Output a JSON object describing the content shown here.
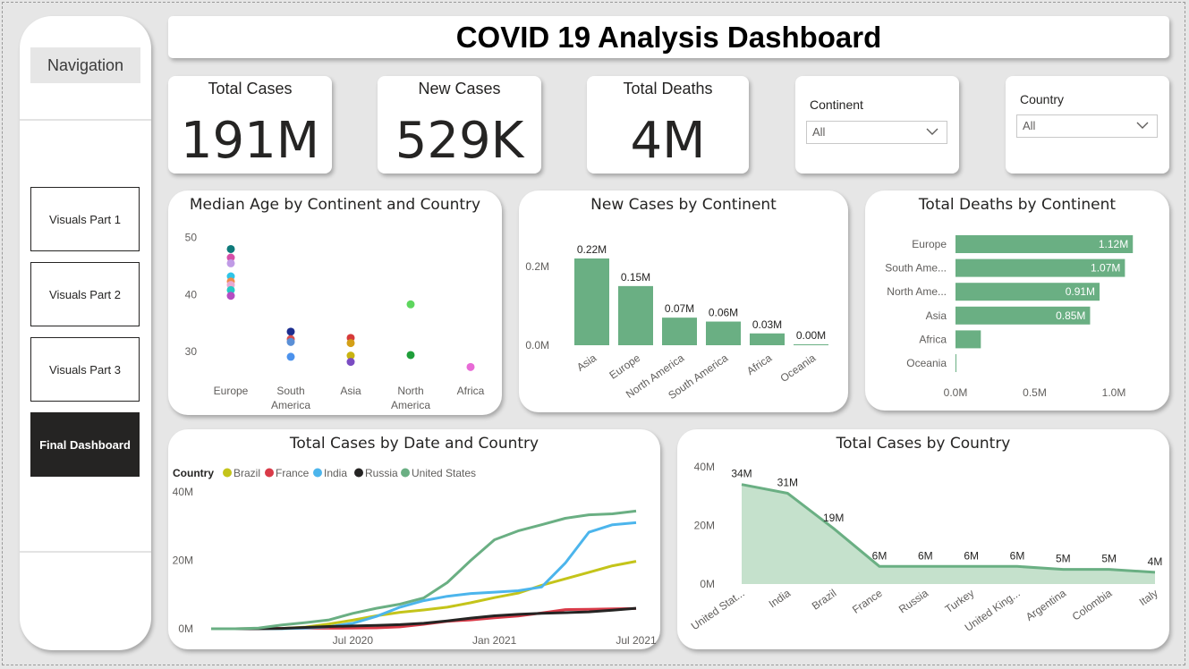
{
  "navigation": {
    "title": "Navigation",
    "buttons": [
      "Visuals Part 1",
      "Visuals Part 2",
      "Visuals Part 3",
      "Final Dashboard"
    ],
    "active": "Final Dashboard"
  },
  "dashboard_title": "COVID 19 Analysis Dashboard",
  "kpis": [
    {
      "label": "Total Cases",
      "value": "191M"
    },
    {
      "label": "New Cases",
      "value": "529K"
    },
    {
      "label": "Total Deaths",
      "value": "4M"
    }
  ],
  "slicers": [
    {
      "label": "Continent",
      "value": "All"
    },
    {
      "label": "Country",
      "value": "All"
    }
  ],
  "colors": {
    "accent_green": "#6aaf83",
    "area_fill": "#c5e1cc",
    "brazil": "#c4c41a",
    "france": "#d93a48",
    "india": "#4cb5ec",
    "russia": "#252423",
    "united_states": "#6aaf83"
  },
  "chart_data": [
    {
      "id": "median-age",
      "type": "scatter",
      "title": "Median Age by Continent and Country",
      "categories": [
        "Europe",
        "South America",
        "Asia",
        "North America",
        "Africa"
      ],
      "ylim": [
        25,
        52
      ],
      "yticks": [
        30,
        40,
        50
      ],
      "points": [
        {
          "category": "Europe",
          "y": 48.0,
          "color": "#0e7a7a"
        },
        {
          "category": "Europe",
          "y": 46.5,
          "color": "#d64fa8"
        },
        {
          "category": "Europe",
          "y": 45.5,
          "color": "#c09be6"
        },
        {
          "category": "Europe",
          "y": 43.2,
          "color": "#2ec5e8"
        },
        {
          "category": "Europe",
          "y": 42.3,
          "color": "#f08a4b"
        },
        {
          "category": "Europe",
          "y": 41.7,
          "color": "#e8a9d2"
        },
        {
          "category": "Europe",
          "y": 40.8,
          "color": "#23c9c4"
        },
        {
          "category": "Europe",
          "y": 39.8,
          "color": "#b54dc2"
        },
        {
          "category": "South America",
          "y": 33.5,
          "color": "#1b2d8f"
        },
        {
          "category": "South America",
          "y": 32.2,
          "color": "#d64f4f"
        },
        {
          "category": "South America",
          "y": 31.7,
          "color": "#5a8fd6"
        },
        {
          "category": "South America",
          "y": 29.1,
          "color": "#4c92ec"
        },
        {
          "category": "Asia",
          "y": 32.4,
          "color": "#d63a3a"
        },
        {
          "category": "Asia",
          "y": 31.5,
          "color": "#d4a017"
        },
        {
          "category": "Asia",
          "y": 29.3,
          "color": "#c9b312"
        },
        {
          "category": "Asia",
          "y": 28.2,
          "color": "#7a4cc2"
        },
        {
          "category": "North America",
          "y": 38.3,
          "color": "#5ed65e"
        },
        {
          "category": "North America",
          "y": 29.4,
          "color": "#1f9e3a"
        },
        {
          "category": "Africa",
          "y": 27.3,
          "color": "#e86ad6"
        }
      ]
    },
    {
      "id": "new-cases-continent",
      "type": "bar",
      "title": "New Cases by Continent",
      "categories": [
        "Asia",
        "Europe",
        "North America",
        "South America",
        "Africa",
        "Oceania"
      ],
      "values": [
        0.22,
        0.15,
        0.07,
        0.06,
        0.03,
        0.0
      ],
      "data_labels": [
        "0.22M",
        "0.15M",
        "0.07M",
        "0.06M",
        "0.03M",
        "0.00M"
      ],
      "yticks": [
        "0.0M",
        "0.2M"
      ],
      "ylim": [
        0,
        0.22
      ]
    },
    {
      "id": "total-deaths-continent",
      "type": "bar",
      "title": "Total Deaths by Continent",
      "categories": [
        "Europe",
        "South Ame...",
        "North Ame...",
        "Asia",
        "Africa",
        "Oceania"
      ],
      "values": [
        1.12,
        1.07,
        0.91,
        0.85,
        0.16,
        0.001
      ],
      "data_labels": [
        "1.12M",
        "1.07M",
        "0.91M",
        "0.85M",
        "",
        ""
      ],
      "xticks": [
        "0.0M",
        "0.5M",
        "1.0M"
      ],
      "xlim": [
        0,
        1.2
      ]
    },
    {
      "id": "total-cases-date",
      "type": "line",
      "title": "Total Cases by Date and Country",
      "legend_title": "Country",
      "xticks": [
        "Jul 2020",
        "Jan 2021",
        "Jul 2021"
      ],
      "yticks": [
        "0M",
        "20M",
        "40M"
      ],
      "ylim": [
        0,
        40
      ],
      "x_range": [
        "2020-01",
        "2021-07"
      ],
      "x": [
        "2020-01",
        "2020-02",
        "2020-03",
        "2020-04",
        "2020-05",
        "2020-06",
        "2020-07",
        "2020-08",
        "2020-09",
        "2020-10",
        "2020-11",
        "2020-12",
        "2021-01",
        "2021-02",
        "2021-03",
        "2021-04",
        "2021-05",
        "2021-06",
        "2021-07"
      ],
      "series": [
        {
          "name": "Brazil",
          "values": [
            0,
            0,
            0,
            0.1,
            0.5,
            1.4,
            2.5,
            3.8,
            4.8,
            5.5,
            6.3,
            7.6,
            9.1,
            10.4,
            12.7,
            14.6,
            16.5,
            18.4,
            19.7
          ]
        },
        {
          "name": "France",
          "values": [
            0,
            0,
            0.05,
            0.13,
            0.15,
            0.16,
            0.18,
            0.26,
            0.56,
            1.3,
            2.2,
            2.6,
            3.2,
            3.7,
            4.6,
            5.6,
            5.7,
            5.8,
            5.9
          ]
        },
        {
          "name": "India",
          "values": [
            0,
            0,
            0,
            0.03,
            0.2,
            0.6,
            1.6,
            3.6,
            6.3,
            8.2,
            9.5,
            10.3,
            10.7,
            11.1,
            12.2,
            19.2,
            28.2,
            30.4,
            31.0
          ]
        },
        {
          "name": "Russia",
          "values": [
            0,
            0,
            0,
            0.1,
            0.4,
            0.65,
            0.8,
            0.98,
            1.2,
            1.6,
            2.3,
            3.1,
            3.8,
            4.2,
            4.5,
            4.7,
            4.95,
            5.4,
            6.0
          ]
        },
        {
          "name": "United States",
          "values": [
            0,
            0,
            0.2,
            1.1,
            1.8,
            2.6,
            4.5,
            6.0,
            7.2,
            9.0,
            13.5,
            20.0,
            26.0,
            28.6,
            30.4,
            32.3,
            33.3,
            33.6,
            34.4
          ]
        }
      ]
    },
    {
      "id": "total-cases-country",
      "type": "area",
      "title": "Total Cases by Country",
      "categories": [
        "United Stat...",
        "India",
        "Brazil",
        "France",
        "Russia",
        "Turkey",
        "United King...",
        "Argentina",
        "Colombia",
        "Italy"
      ],
      "values": [
        34,
        31,
        19,
        6,
        6,
        6,
        6,
        5,
        5,
        4
      ],
      "data_labels": [
        "34M",
        "31M",
        "19M",
        "6M",
        "6M",
        "6M",
        "6M",
        "5M",
        "5M",
        "4M"
      ],
      "yticks": [
        "0M",
        "20M",
        "40M"
      ],
      "ylim": [
        0,
        40
      ]
    }
  ]
}
